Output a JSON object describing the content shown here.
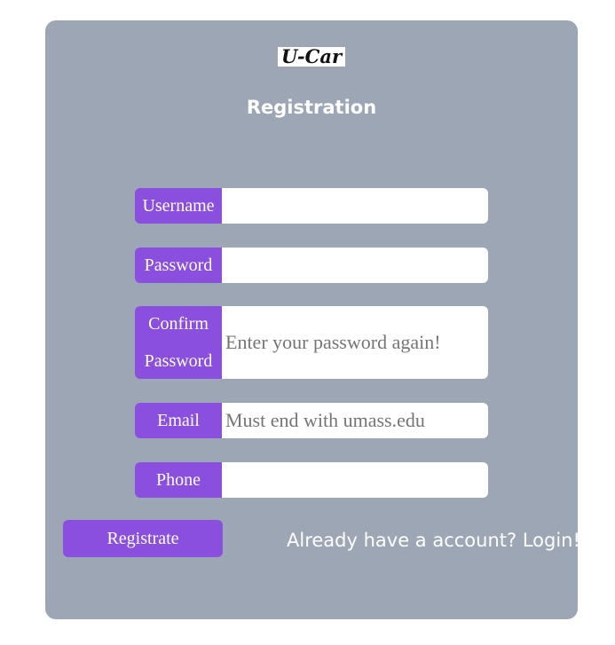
{
  "brand": {
    "logo_text": "U-Car"
  },
  "form": {
    "title": "Registration",
    "fields": [
      {
        "label": "Username",
        "value": "",
        "placeholder": ""
      },
      {
        "label": "Password",
        "value": "",
        "placeholder": ""
      },
      {
        "label_line1": "Confirm",
        "label_line2": "Password",
        "value": "",
        "placeholder": "Enter your password again!"
      },
      {
        "label": "Email",
        "value": "",
        "placeholder": "Must end with umass.edu"
      },
      {
        "label": "Phone",
        "value": "",
        "placeholder": ""
      }
    ],
    "submit_label": "Registrate",
    "login_link": "Already have a account? Login!"
  },
  "colors": {
    "card_background": "#9ca6b5",
    "accent": "#8b4fe0",
    "text_light": "#ffffff"
  }
}
